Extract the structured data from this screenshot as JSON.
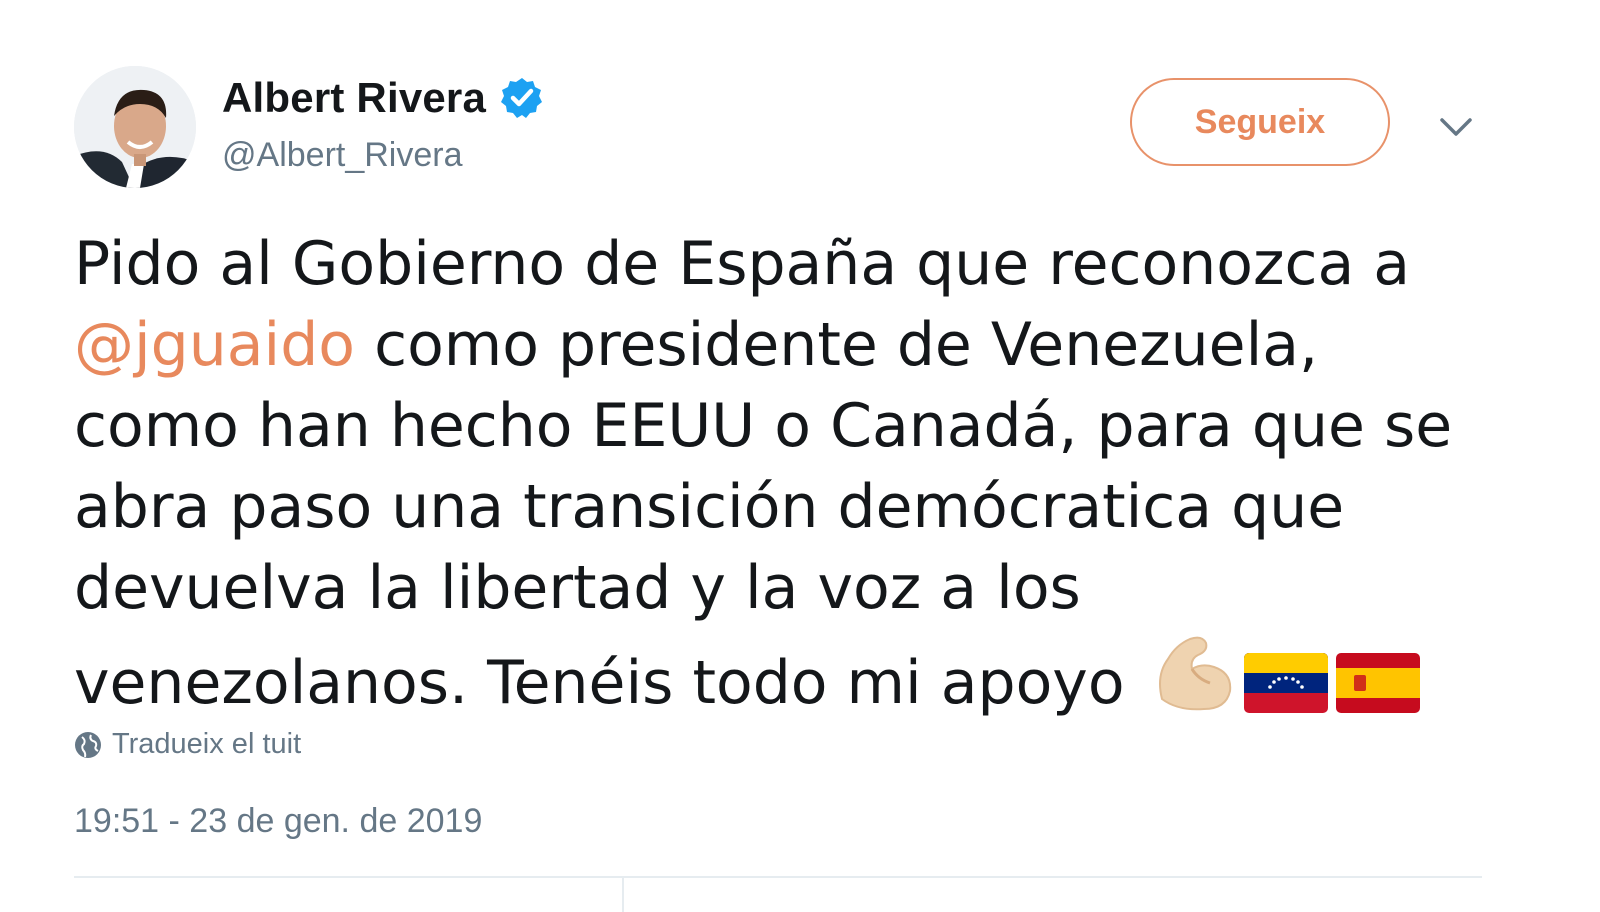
{
  "author": {
    "display_name": "Albert Rivera",
    "handle": "@Albert_Rivera",
    "verified": true
  },
  "follow_button": {
    "label": "Segueix"
  },
  "tweet": {
    "lines": [
      "Pido al Gobierno de España que reconozca a",
      " como presidente de Venezuela,",
      "como han hecho EEUU o Canadá, para que se",
      "abra paso una transición demócratica que",
      "devuelva la libertad y la voz a los",
      "venezolanos. Tenéis todo mi apoyo "
    ],
    "mention": "@jguaido",
    "emojis": [
      "flexed-biceps-light-skin-tone",
      "flag-venezuela",
      "flag-spain"
    ]
  },
  "translate": {
    "label": "Tradueix el tuit"
  },
  "timestamp": "19:51 - 23 de gen. de 2019",
  "colors": {
    "accent": "#e8895d",
    "text": "#14171a",
    "muted": "#657786",
    "verified": "#1da1f2"
  }
}
